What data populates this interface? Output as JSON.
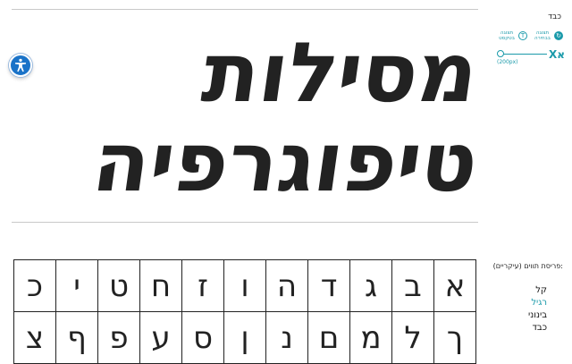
{
  "hero": {
    "line1": "מסילות",
    "line2": "טיפוגרפיה"
  },
  "sidebar": {
    "weight_label": "כבד",
    "view_options": [
      {
        "label": "תצוגה בבחירה",
        "icon": "cycle-icon",
        "active": true
      },
      {
        "label": "תצוגה בטקסט",
        "icon": "text-view-icon",
        "active": false
      }
    ],
    "size_glyph": "אX",
    "size_value": "(200px)",
    "sets_title": ":פריסת תווים (עיקריים)",
    "weights": [
      {
        "label": "קל",
        "active": false
      },
      {
        "label": "רגיל",
        "active": true
      },
      {
        "label": "בינוני",
        "active": false
      },
      {
        "label": "כבד",
        "active": false
      }
    ]
  },
  "glyphs": {
    "row1": [
      "א",
      "ב",
      "ג",
      "ד",
      "ה",
      "ו",
      "ז",
      "ח",
      "ט",
      "י",
      "כ"
    ],
    "row2": [
      "ך",
      "ל",
      "מ",
      "ם",
      "נ",
      "ן",
      "ס",
      "ע",
      "פ",
      "ף",
      "צ"
    ]
  },
  "colors": {
    "accent": "#1a9aaa",
    "a11y": "#1a73c8",
    "text": "#222222"
  }
}
